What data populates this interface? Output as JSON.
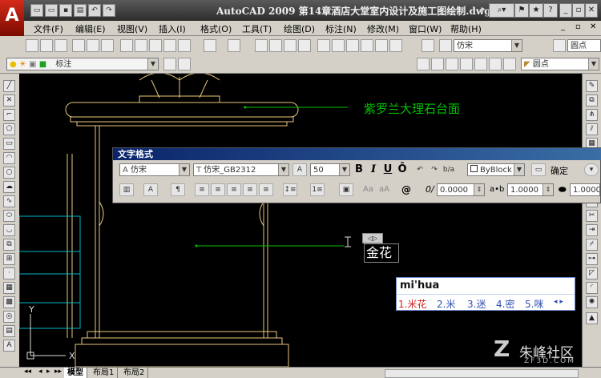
{
  "window": {
    "title": "AutoCAD 2009   第14章酒店大堂室内设计及施工图绘制.dwg",
    "app_logo": "A"
  },
  "menu": [
    "文件(F)",
    "编辑(E)",
    "视图(V)",
    "插入(I)",
    "格式(O)",
    "工具(T)",
    "绘图(D)",
    "标注(N)",
    "修改(M)",
    "窗口(W)",
    "帮助(H)"
  ],
  "toolbar1": {
    "font_combo": "仿宋",
    "style_combo": "圆点"
  },
  "toolbar2": {
    "layer_combo": "标注",
    "right_combo": "圆点"
  },
  "drawing": {
    "annotation": "紫罗兰大理石台面",
    "mtext_value": "金花",
    "mtext_handle": "◁▷",
    "ucs_x": "X",
    "ucs_y": "Y"
  },
  "text_format": {
    "title": "文字格式",
    "style": "仿宋",
    "font": "仿宋_GB2312",
    "height": "50",
    "bold": "B",
    "italic": "I",
    "underline": "U",
    "overline": "Ō",
    "color": "ByBlock",
    "ok": "确定",
    "oblique": "0.0000",
    "tracking": "1.0000",
    "width_factor": "1.0000",
    "case_upper": "Aa",
    "case_lower": "aA",
    "symbol": "@",
    "oblique_label": "0/",
    "tracking_label": "a•b"
  },
  "ime": {
    "input": "mi'hua",
    "candidates": [
      "1.米花",
      "2.米",
      "3.迷",
      "4.密",
      "5.咪"
    ],
    "nav": "◂ ▸"
  },
  "layout_tabs": [
    "模型",
    "布局1",
    "布局2"
  ],
  "watermark": {
    "brand": "朱峰社区",
    "url": "ZF3D.COM"
  },
  "colors": {
    "annotation": "#00c000",
    "drawing_line": "#e8c87a",
    "cyan_line": "#00b8c8"
  }
}
